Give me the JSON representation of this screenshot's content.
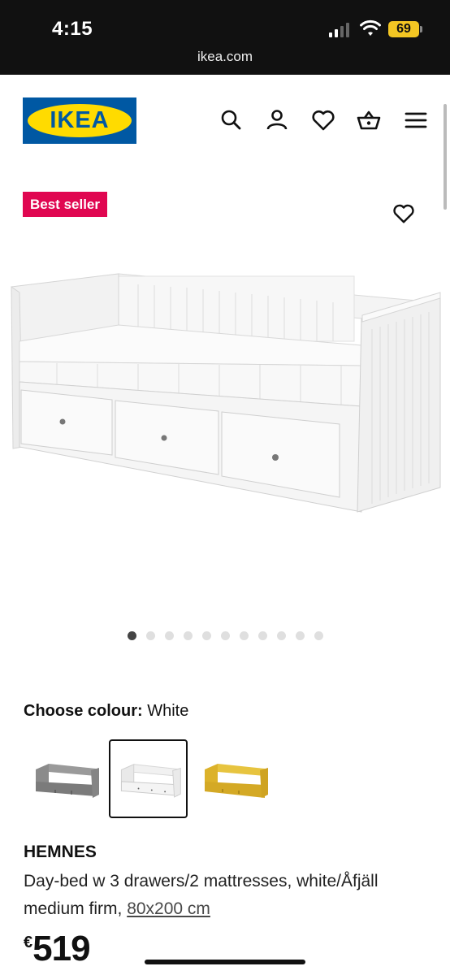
{
  "status_bar": {
    "time": "4:15",
    "battery": "69",
    "url": "ikea.com"
  },
  "header": {
    "logo_text": "IKEA",
    "icons": [
      "search-icon",
      "account-icon",
      "heart-icon",
      "basket-icon",
      "menu-icon"
    ]
  },
  "product": {
    "badge": "Best seller",
    "name": "HEMNES",
    "description": "Day-bed w 3 drawers/2 mattresses, white/Åfjäll medium firm,",
    "size_link": "80x200 cm",
    "price_currency": "€",
    "price_amount": "519"
  },
  "gallery": {
    "image_count": 11,
    "active_index": 0
  },
  "colour": {
    "label": "Choose colour:",
    "selected": "White",
    "options": [
      "Grey",
      "White",
      "Yellow"
    ],
    "selected_index": 1
  },
  "colors": {
    "brand_blue": "#0058a3",
    "brand_yellow": "#ffdb00",
    "badge_red": "#e00751"
  }
}
